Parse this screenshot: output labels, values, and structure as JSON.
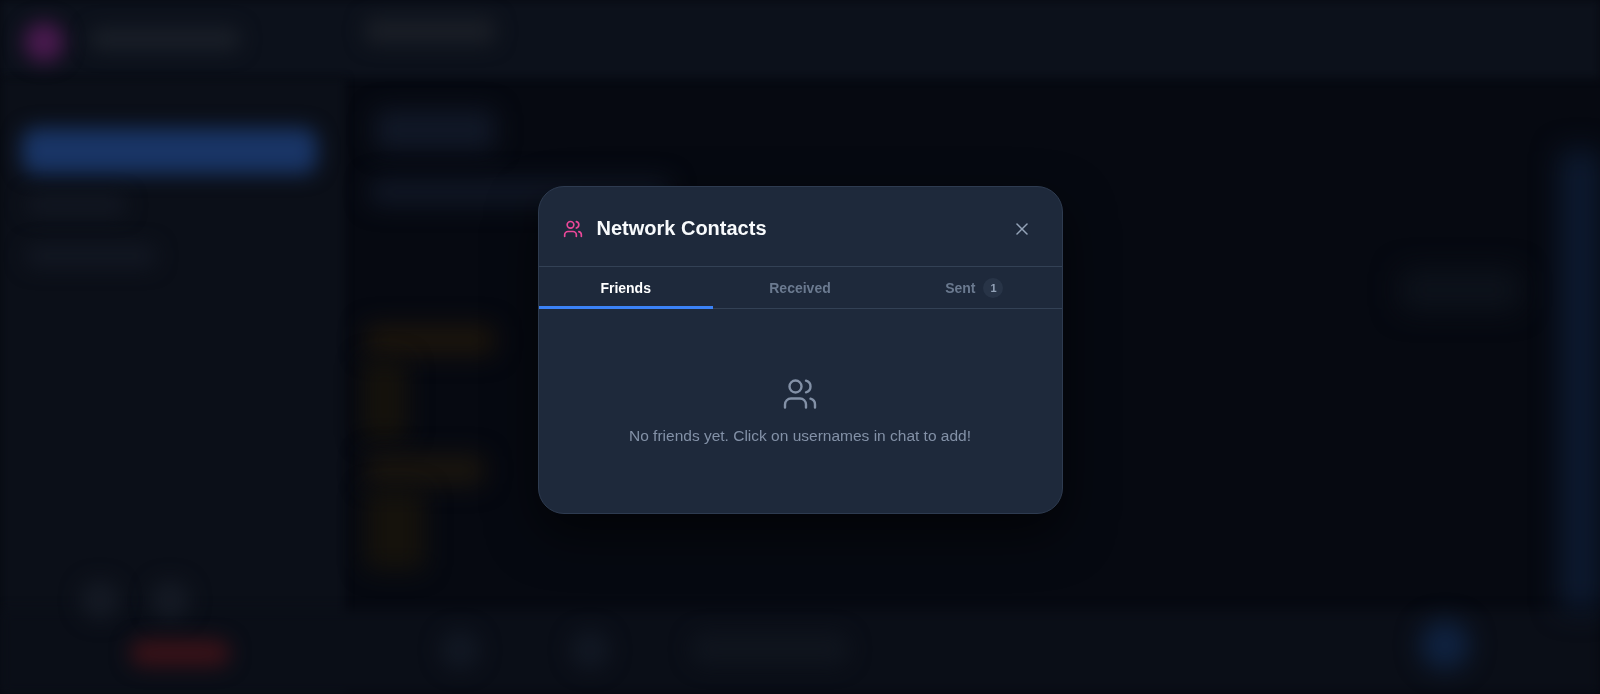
{
  "dialog": {
    "title": "Network Contacts",
    "tabs": [
      {
        "label": "Friends",
        "selected": true
      },
      {
        "label": "Received",
        "selected": false
      },
      {
        "label": "Sent",
        "selected": false,
        "badge": "1"
      }
    ],
    "empty_state": {
      "message": "No friends yet. Click on usernames in chat to add!"
    }
  }
}
